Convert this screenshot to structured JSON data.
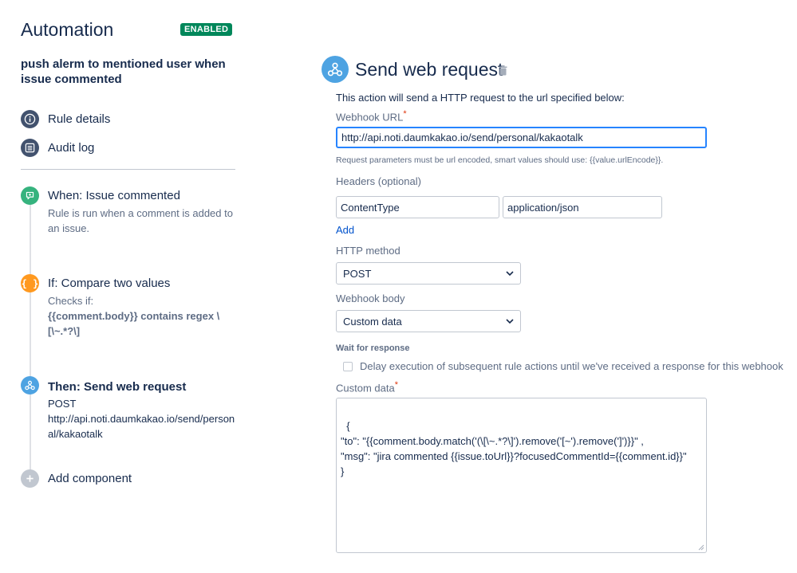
{
  "header": {
    "title": "Automation",
    "status_badge": "ENABLED"
  },
  "rule": {
    "name": "push alerm to mentioned user when issue commented"
  },
  "nav": {
    "rule_details": "Rule details",
    "audit_log": "Audit log"
  },
  "steps": {
    "trigger": {
      "title": "When: Issue commented",
      "description": "Rule is run when a comment is added to an issue."
    },
    "condition": {
      "title": "If: Compare two values",
      "description_prefix": "Checks if:",
      "description_expr": "{{comment.body}} contains regex \\[\\~.*?\\]"
    },
    "action": {
      "title": "Then: Send web request",
      "method": "POST",
      "url": "http://api.noti.daumkakao.io/send/personal/kakaotalk"
    },
    "add_component": "Add component"
  },
  "panel": {
    "title": "Send web request",
    "intro": "This action will send a HTTP request to the url specified below:",
    "webhook_url": {
      "label": "Webhook URL",
      "required_mark": "*",
      "value": "http://api.noti.daumkakao.io/send/personal/kakaotalk",
      "help": "Request parameters must be url encoded, smart values should use: {{value.urlEncode}}."
    },
    "headers": {
      "label": "Headers (optional)",
      "key": "ContentType",
      "value": "application/json",
      "add_label": "Add"
    },
    "http_method": {
      "label": "HTTP method",
      "selected": "POST"
    },
    "webhook_body": {
      "label": "Webhook body",
      "selected": "Custom data"
    },
    "wait_for_response": {
      "label": "Wait for response",
      "checkbox_label": "Delay execution of subsequent rule actions until we've received a response for this webhook",
      "checked": false
    },
    "custom_data": {
      "label": "Custom data",
      "required_mark": "*",
      "value": "{\n\"to\": \"{{comment.body.match('(\\[\\~.*?\\]').remove('[~').remove(']')}}\" ,\n\"msg\": \"jira commented {{issue.toUrl}}?focusedCommentId={{comment.id}}\"\n}"
    }
  },
  "colors": {
    "badge": "#00875a",
    "nav_icon": "#42526e",
    "trigger_icon": "#36b37e",
    "condition_icon": "#ff991f",
    "action_icon": "#4ea3e2",
    "add_icon": "#c1c7d0",
    "link": "#0052cc",
    "focus": "#2684ff",
    "required": "#de350b"
  },
  "icons": {
    "rule_details": "info-icon",
    "audit_log": "list-icon",
    "trigger": "comment-icon",
    "condition": "braces-icon",
    "action": "webhook-icon",
    "add": "plus-icon",
    "delete": "trash-icon",
    "select": "chevron-down-icon",
    "resize": "resize-grip-icon"
  }
}
